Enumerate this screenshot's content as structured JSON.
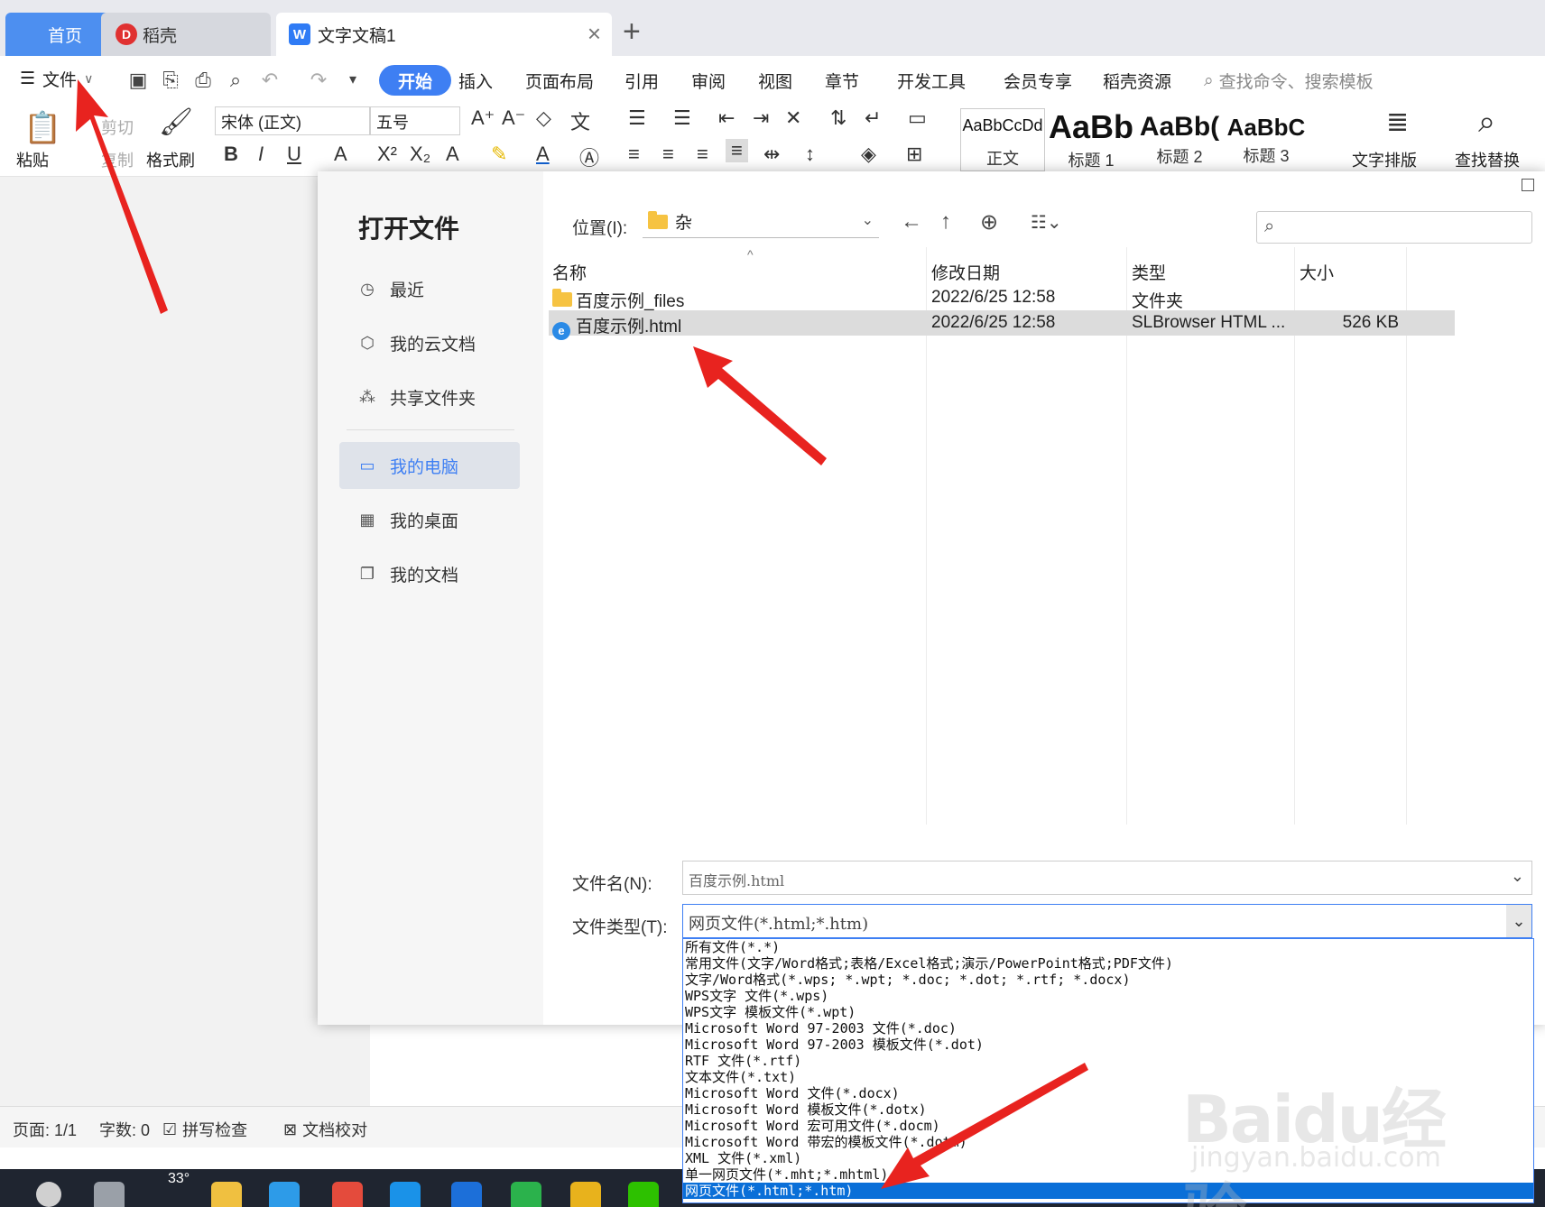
{
  "tabs": {
    "home": "首页",
    "daoke": "稻壳",
    "doc": "文字文稿1"
  },
  "menu": {
    "file": "文件",
    "items": [
      "开始",
      "插入",
      "页面布局",
      "引用",
      "审阅",
      "视图",
      "章节",
      "开发工具",
      "会员专享",
      "稻壳资源"
    ],
    "search": "查找命令、搜索模板"
  },
  "ribbon": {
    "paste": "粘贴",
    "cut": "剪切",
    "copy": "复制",
    "format_painter": "格式刷",
    "font": "宋体 (正文)",
    "size": "五号",
    "styles": [
      {
        "sample": "AaBbCcDd",
        "name": "正文"
      },
      {
        "sample": "AaBb",
        "name": "标题 1"
      },
      {
        "sample": "AaBb(",
        "name": "标题 2"
      },
      {
        "sample": "AaBbC",
        "name": "标题 3"
      }
    ],
    "text_layout": "文字排版",
    "find_replace": "查找替换"
  },
  "dialog": {
    "title": "打开文件",
    "location_label": "位置(I):",
    "location_value": "杂",
    "nav": [
      {
        "label": "最近",
        "icon": "clock-icon"
      },
      {
        "label": "我的云文档",
        "icon": "cube-icon"
      },
      {
        "label": "共享文件夹",
        "icon": "share-icon"
      },
      {
        "label": "我的电脑",
        "icon": "computer-icon"
      },
      {
        "label": "我的桌面",
        "icon": "desktop-icon"
      },
      {
        "label": "我的文档",
        "icon": "documents-icon"
      }
    ],
    "columns": [
      "名称",
      "修改日期",
      "类型",
      "大小"
    ],
    "files": [
      {
        "name": "百度示例_files",
        "date": "2022/6/25 12:58",
        "type": "文件夹",
        "size": ""
      },
      {
        "name": "百度示例.html",
        "date": "2022/6/25 12:58",
        "type": "SLBrowser HTML ...",
        "size": "526 KB"
      }
    ],
    "filename_label": "文件名(N):",
    "filename_value": "百度示例.html",
    "filetype_label": "文件类型(T):",
    "filetype_value": "网页文件(*.html;*.htm)",
    "filetype_options": [
      "所有文件(*.*)",
      "常用文件(文字/Word格式;表格/Excel格式;演示/PowerPoint格式;PDF文件)",
      "文字/Word格式(*.wps; *.wpt; *.doc; *.dot; *.rtf; *.docx)",
      "WPS文字 文件(*.wps)",
      "WPS文字 模板文件(*.wpt)",
      "Microsoft Word 97-2003 文件(*.doc)",
      "Microsoft Word 97-2003 模板文件(*.dot)",
      "RTF 文件(*.rtf)",
      "文本文件(*.txt)",
      "Microsoft Word 文件(*.docx)",
      "Microsoft Word 模板文件(*.dotx)",
      "Microsoft Word 宏可用文件(*.docm)",
      "Microsoft Word 带宏的模板文件(*.dotm)",
      "XML 文件(*.xml)",
      "单一网页文件(*.mht;*.mhtml)",
      "网页文件(*.html;*.htm)"
    ],
    "selected_option_index": 15
  },
  "status": {
    "page": "页面: 1/1",
    "words": "字数: 0",
    "spell": "拼写检查",
    "proof": "文档校对"
  },
  "taskbar": {
    "temperature": "33°"
  },
  "watermark": {
    "brand": "Baidu经验",
    "url": "jingyan.baidu.com"
  },
  "colors": {
    "accent": "#3e7ff3",
    "home_tab": "#4d8ff0",
    "arrow": "#e8231f",
    "selected_option": "#0a6fd8"
  }
}
